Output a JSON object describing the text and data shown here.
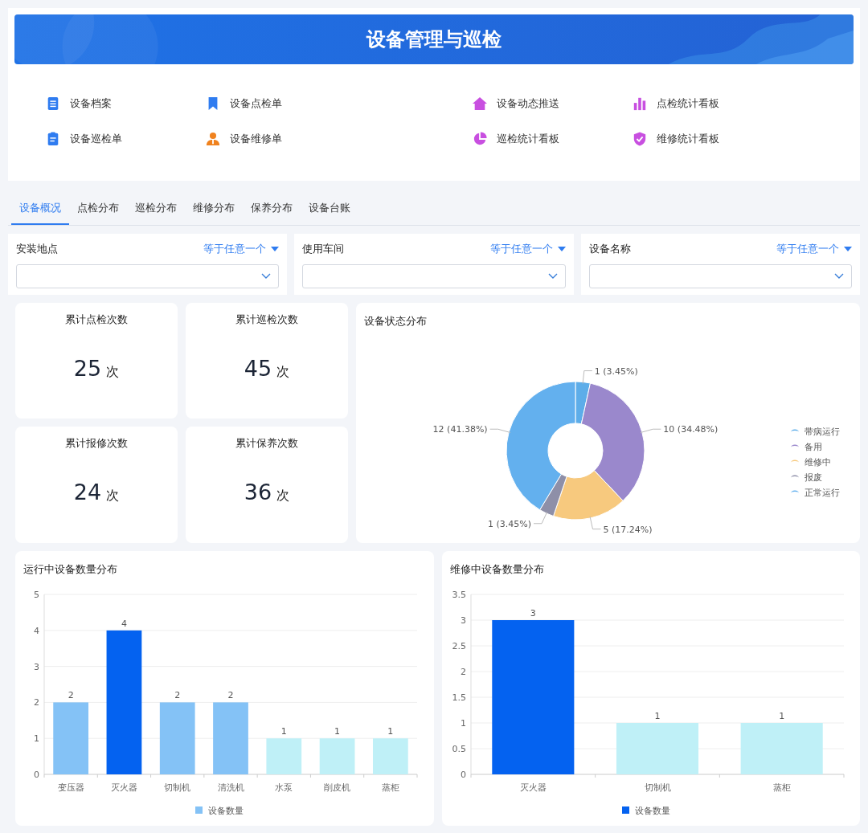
{
  "header": {
    "title": "设备管理与巡检"
  },
  "quick_links": [
    {
      "label": "设备档案",
      "color": "#2f7cf0"
    },
    {
      "label": "设备点检单",
      "color": "#2f7cf0"
    },
    {
      "label": "设备动态推送",
      "color": "#c84fe0"
    },
    {
      "label": "点检统计看板",
      "color": "#c84fe0"
    },
    {
      "label": "设备巡检单",
      "color": "#2f7cf0"
    },
    {
      "label": "设备维修单",
      "color": "#f0821e"
    },
    {
      "label": "巡检统计看板",
      "color": "#c84fe0"
    },
    {
      "label": "维修统计看板",
      "color": "#c84fe0"
    }
  ],
  "tabs": [
    {
      "label": "设备概况",
      "selected": true
    },
    {
      "label": "点检分布",
      "selected": false
    },
    {
      "label": "巡检分布",
      "selected": false
    },
    {
      "label": "维修分布",
      "selected": false
    },
    {
      "label": "保养分布",
      "selected": false
    },
    {
      "label": "设备台账",
      "selected": false
    }
  ],
  "filters": [
    {
      "label": "安装地点",
      "operator": "等于任意一个"
    },
    {
      "label": "使用车间",
      "operator": "等于任意一个"
    },
    {
      "label": "设备名称",
      "operator": "等于任意一个"
    }
  ],
  "stats": [
    {
      "label": "累计点检次数",
      "value": "25",
      "unit": "次"
    },
    {
      "label": "累计巡检次数",
      "value": "45",
      "unit": "次"
    },
    {
      "label": "累计报修次数",
      "value": "24",
      "unit": "次"
    },
    {
      "label": "累计保养次数",
      "value": "36",
      "unit": "次"
    }
  ],
  "status_chart": {
    "title": "设备状态分布",
    "chart_data": {
      "type": "donut",
      "categories": [
        "带病运行",
        "备用",
        "维修中",
        "报废",
        "正常运行"
      ],
      "values": [
        3.45,
        34.48,
        17.24,
        3.45,
        41.38
      ],
      "colors": [
        "#5dade9",
        "#9a88cc",
        "#f7c97e",
        "#8e8fa8",
        "#63b0ee"
      ],
      "value_labels": [
        "1 (3.45%)",
        "10 (34.48%)",
        "5 (17.24%)",
        "1 (3.45%)",
        "12 (41.38%)"
      ],
      "legend": "right"
    }
  },
  "running_chart": {
    "title": "运行中设备数量分布",
    "chart_data": {
      "type": "bar",
      "categories": [
        "变压器",
        "灭火器",
        "切制机",
        "清洗机",
        "水泵",
        "削皮机",
        "蒸柜"
      ],
      "series": [
        {
          "name": "设备数量",
          "values": [
            2,
            4,
            2,
            2,
            1,
            1,
            1
          ]
        }
      ],
      "colors": [
        "#84c2f6",
        "#0462f0",
        "#84c2f6",
        "#84c2f6",
        "#bff0f7",
        "#bff0f7",
        "#bff0f7"
      ],
      "ylim": [
        0,
        5
      ],
      "yticks": [
        0,
        1,
        2,
        3,
        4,
        5
      ],
      "data_labels": true,
      "grid": true,
      "legend": "bottom"
    }
  },
  "repair_chart": {
    "title": "维修中设备数量分布",
    "chart_data": {
      "type": "bar",
      "categories": [
        "灭火器",
        "切制机",
        "蒸柜"
      ],
      "series": [
        {
          "name": "设备数量",
          "values": [
            3,
            1,
            1
          ]
        }
      ],
      "colors": [
        "#0462f0",
        "#bff0f7",
        "#bff0f7"
      ],
      "ylim": [
        0,
        3.5
      ],
      "yticks": [
        0,
        0.5,
        1,
        1.5,
        2,
        2.5,
        3,
        3.5
      ],
      "data_labels": true,
      "grid": true,
      "legend": "bottom"
    }
  }
}
